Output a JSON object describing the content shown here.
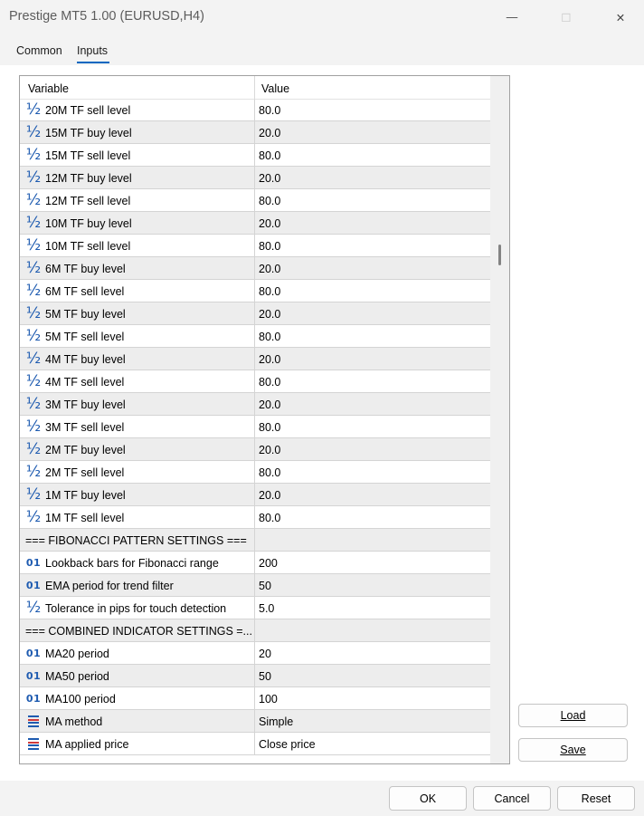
{
  "window": {
    "title": "Prestige MT5 1.00 (EURUSD,H4)",
    "minimize_glyph": "—",
    "maximize_glyph": "☐",
    "close_glyph": "✕"
  },
  "tabs": [
    {
      "label": "Common",
      "active": false
    },
    {
      "label": "Inputs",
      "active": true
    }
  ],
  "table": {
    "headers": {
      "variable": "Variable",
      "value": "Value"
    },
    "rows": [
      {
        "type": "double",
        "name": "20M TF sell level",
        "value": "80.0"
      },
      {
        "type": "double",
        "name": "15M TF buy level",
        "value": "20.0"
      },
      {
        "type": "double",
        "name": "15M TF sell level",
        "value": "80.0"
      },
      {
        "type": "double",
        "name": "12M TF buy level",
        "value": "20.0"
      },
      {
        "type": "double",
        "name": "12M TF sell level",
        "value": "80.0"
      },
      {
        "type": "double",
        "name": "10M TF buy level",
        "value": "20.0"
      },
      {
        "type": "double",
        "name": "10M TF sell level",
        "value": "80.0"
      },
      {
        "type": "double",
        "name": "6M TF buy level",
        "value": "20.0"
      },
      {
        "type": "double",
        "name": "6M TF sell level",
        "value": "80.0"
      },
      {
        "type": "double",
        "name": "5M TF buy level",
        "value": "20.0"
      },
      {
        "type": "double",
        "name": "5M TF sell level",
        "value": "80.0"
      },
      {
        "type": "double",
        "name": "4M TF buy level",
        "value": "20.0"
      },
      {
        "type": "double",
        "name": "4M TF sell level",
        "value": "80.0"
      },
      {
        "type": "double",
        "name": "3M TF buy level",
        "value": "20.0"
      },
      {
        "type": "double",
        "name": "3M TF sell level",
        "value": "80.0"
      },
      {
        "type": "double",
        "name": "2M TF buy level",
        "value": "20.0"
      },
      {
        "type": "double",
        "name": "2M TF sell level",
        "value": "80.0"
      },
      {
        "type": "double",
        "name": "1M TF buy level",
        "value": "20.0"
      },
      {
        "type": "double",
        "name": "1M TF sell level",
        "value": "80.0"
      },
      {
        "type": "section",
        "name": "=== FIBONACCI PATTERN SETTINGS ===",
        "value": ""
      },
      {
        "type": "int",
        "name": "Lookback bars for Fibonacci range",
        "value": "200"
      },
      {
        "type": "int",
        "name": "EMA period for trend filter",
        "value": "50"
      },
      {
        "type": "double",
        "name": "Tolerance in pips for touch detection",
        "value": "5.0"
      },
      {
        "type": "section",
        "name": "=== COMBINED INDICATOR SETTINGS =...",
        "value": ""
      },
      {
        "type": "int",
        "name": "MA20 period",
        "value": "20"
      },
      {
        "type": "int",
        "name": "MA50 period",
        "value": "50"
      },
      {
        "type": "int",
        "name": "MA100 period",
        "value": "100"
      },
      {
        "type": "enum",
        "name": "MA method",
        "value": "Simple"
      },
      {
        "type": "enum",
        "name": "MA applied price",
        "value": "Close price"
      }
    ]
  },
  "icons": {
    "double": "½",
    "int": "01",
    "enum_colors": [
      "#1e5bb0",
      "#d03a3a",
      "#1e5bb0",
      "#1e5bb0"
    ]
  },
  "buttons": {
    "load": "Load",
    "save": "Save",
    "ok": "OK",
    "cancel": "Cancel",
    "reset": "Reset"
  }
}
